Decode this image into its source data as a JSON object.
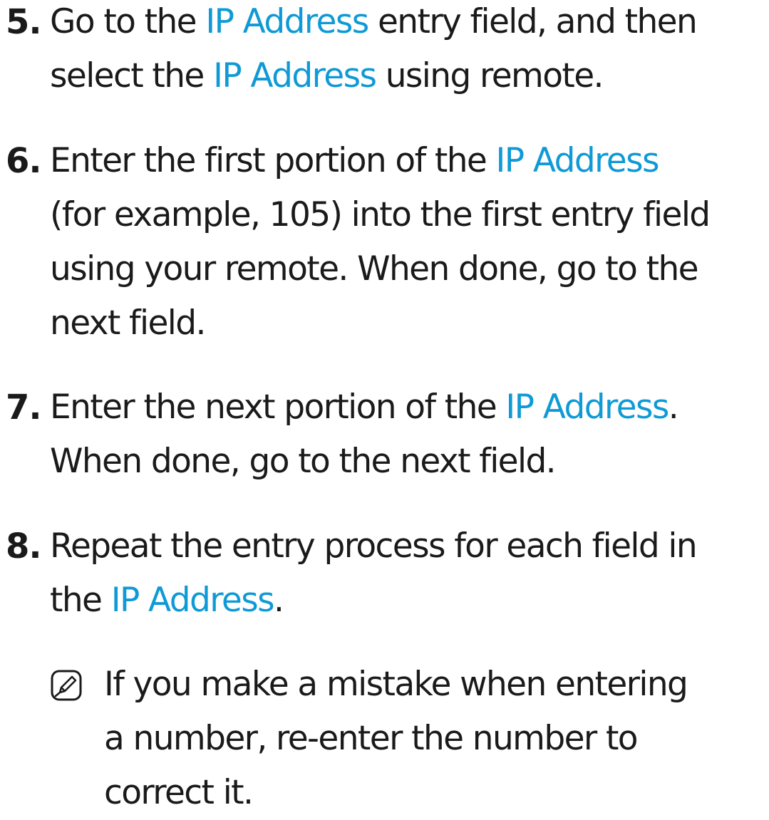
{
  "steps": [
    {
      "number": "5.",
      "lines": [
        [
          "Go to the ",
          "IP Address",
          " entry field, and then"
        ],
        [
          "select the ",
          "IP Address",
          " using remote."
        ]
      ]
    },
    {
      "number": "6.",
      "lines": [
        [
          "Enter the first portion of the ",
          "IP Address",
          ""
        ],
        [
          "(for example, 105) into the first entry field",
          "",
          ""
        ],
        [
          "using your remote. When done, go to the",
          "",
          ""
        ],
        [
          "next field.",
          "",
          ""
        ]
      ]
    },
    {
      "number": "7.",
      "lines": [
        [
          "Enter the next portion of the ",
          "IP Address",
          "."
        ],
        [
          "When done, go to the next field.",
          "",
          ""
        ]
      ]
    },
    {
      "number": "8.",
      "lines": [
        [
          "Repeat the entry process for each field in",
          "",
          ""
        ],
        [
          "the ",
          "IP Address",
          "."
        ]
      ]
    }
  ],
  "note": {
    "icon": "note-pencil-icon",
    "lines": [
      "If you make a mistake when entering",
      "a number, re-enter the number to",
      "correct it."
    ]
  },
  "colors": {
    "highlight": "#0f9ad6",
    "text": "#1a1a1a"
  }
}
